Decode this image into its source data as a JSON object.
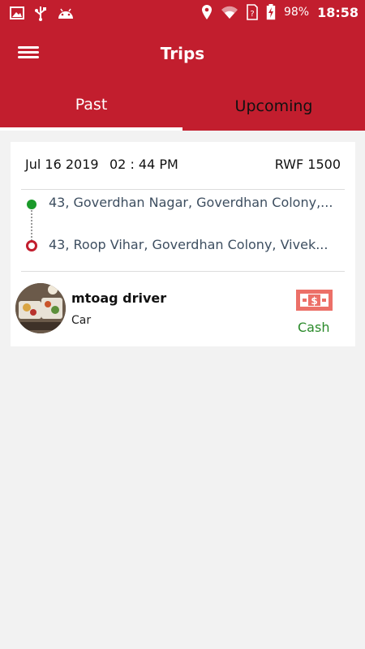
{
  "status_bar": {
    "left_icons": [
      "image-icon",
      "usb-icon",
      "android-icon"
    ],
    "right_icons": [
      "location-icon",
      "wifi-icon",
      "sim-icon",
      "battery-charging-icon"
    ],
    "battery": "98%",
    "time": "18:58"
  },
  "app_bar": {
    "title": "Trips",
    "menu_icon": "hamburger-menu-icon"
  },
  "tabs": [
    {
      "label": "Past",
      "selected": true
    },
    {
      "label": "Upcoming",
      "selected": false
    }
  ],
  "trip": {
    "date": "Jul 16 2019",
    "time": "02 : 44 PM",
    "fare": "RWF 1500",
    "pickup_address": "43, Goverdhan Nagar, Goverdhan Colony,...",
    "drop_address": "43, Roop Vihar, Goverdhan Colony, Vivek...",
    "driver_name": "mtoag driver",
    "vehicle": "Car",
    "payment_method": "Cash",
    "payment_icon": "cash-icon"
  },
  "colors": {
    "primary": "#c21e2e",
    "pickup": "#1a9a2a",
    "cash_text": "#2a8a2a",
    "address_text": "#3d4e60"
  }
}
